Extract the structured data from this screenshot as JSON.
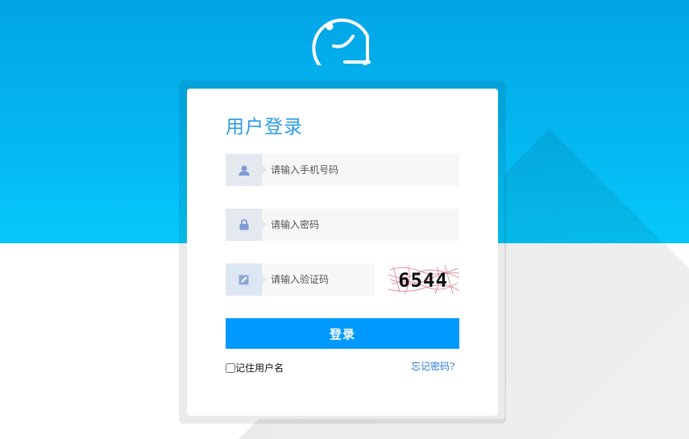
{
  "colors": {
    "background_top": "#02a5e6",
    "accent": "#0099ff",
    "title": "#2a9ae6",
    "link": "#2a7bd6"
  },
  "header": {
    "logo_icon": "smiley-face-logo-icon"
  },
  "login_form": {
    "title": "用户登录",
    "phone": {
      "icon": "user-icon",
      "placeholder": "请输入手机号码",
      "value": ""
    },
    "password": {
      "icon": "lock-icon",
      "placeholder": "请输入密码",
      "value": ""
    },
    "captcha": {
      "icon": "edit-icon",
      "placeholder": "请输入验证码",
      "value": "",
      "image_text": "6544"
    },
    "submit_label": "登录",
    "remember_label": "记住用户名",
    "remember_checked": false,
    "forgot_label": "忘记密码?"
  }
}
